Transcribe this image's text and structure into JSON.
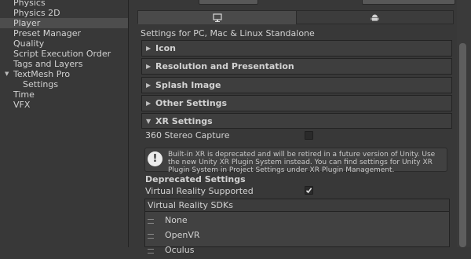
{
  "sidebar": {
    "items": [
      {
        "label": "Physics"
      },
      {
        "label": "Physics 2D"
      },
      {
        "label": "Player"
      },
      {
        "label": "Preset Manager"
      },
      {
        "label": "Quality"
      },
      {
        "label": "Script Execution Order"
      },
      {
        "label": "Tags and Layers"
      },
      {
        "label": "TextMesh Pro"
      },
      {
        "label": "Settings"
      },
      {
        "label": "Time"
      },
      {
        "label": "VFX"
      }
    ],
    "selected_item": "Player",
    "expanded_group": "TextMesh Pro"
  },
  "platform_tabs": [
    {
      "icon": "monitor-icon",
      "active": true
    },
    {
      "icon": "android-icon",
      "active": false
    }
  ],
  "settings_title": "Settings for PC, Mac & Linux Standalone",
  "sections": [
    {
      "label": "Icon"
    },
    {
      "label": "Resolution and Presentation"
    },
    {
      "label": "Splash Image"
    },
    {
      "label": "Other Settings"
    }
  ],
  "xr": {
    "header": "XR Settings",
    "stereo_capture_label": "360 Stereo Capture",
    "stereo_capture_checked": false,
    "help_text": "Built-in XR is deprecated and will be retired in a future version of Unity. Use the new Unity XR Plugin System instead. You can find settings for Unity XR Plugin System in Project Settings under XR Plugin Management.",
    "help_icon": "!",
    "deprecated_header": "Deprecated Settings",
    "vr_supported_label": "Virtual Reality Supported",
    "vr_supported_checked": true,
    "sdk_list_header": "Virtual Reality SDKs",
    "sdks": [
      {
        "label": "None"
      },
      {
        "label": "OpenVR"
      },
      {
        "label": "Oculus"
      }
    ]
  },
  "colors": {
    "background": "#383838",
    "selected": "#4d4d4d",
    "text": "#d2d2d2"
  }
}
